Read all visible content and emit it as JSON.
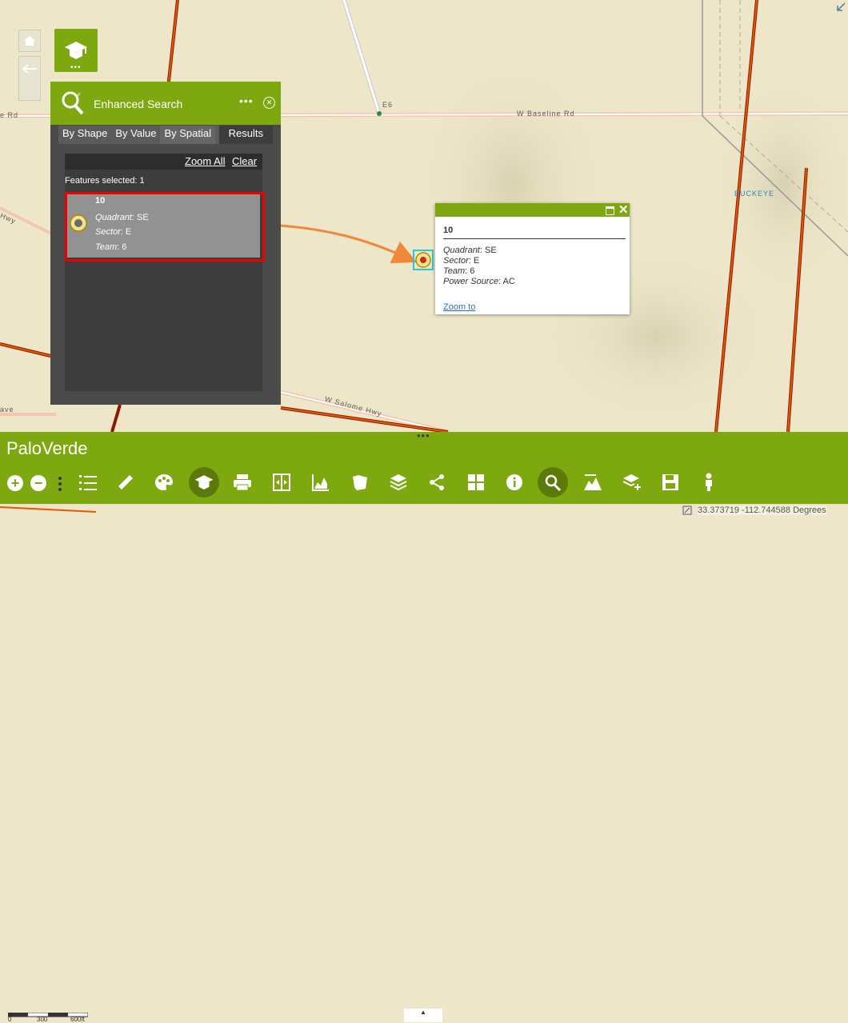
{
  "map": {
    "roads": {
      "baseline": "W Baseline Rd",
      "baseline_left": "e Rd",
      "e6": "E6",
      "buckeye": "BUCKEYE",
      "hwy": "Hwy",
      "saddle": "W Salome Hwy",
      "ave": "ave"
    }
  },
  "widget": {
    "icon": "grad-cap-icon"
  },
  "panel": {
    "title": "Enhanced Search",
    "tabs": [
      "By Shape",
      "By Value",
      "By Spatial",
      "Results"
    ],
    "active_tab": "Results",
    "zoom_all": "Zoom All",
    "clear": "Clear",
    "features_selected": "Features selected: 1",
    "result": {
      "title": "10",
      "rows": [
        {
          "label": "Quadrant",
          "value": ": SE"
        },
        {
          "label": "Sector",
          "value": ": E"
        },
        {
          "label": "Team",
          "value": ": 6"
        }
      ]
    }
  },
  "popup": {
    "title": "10",
    "rows": [
      {
        "label": "Quadrant",
        "value": ": SE"
      },
      {
        "label": "Sector",
        "value": ": E"
      },
      {
        "label": "Team",
        "value": ": 6"
      },
      {
        "label": "Power Source",
        "value": ": AC"
      }
    ],
    "zoom_to": "Zoom to"
  },
  "app": {
    "title": "PaloVerde"
  },
  "status": {
    "coordinates": "33.373719 -112.744588 Degrees"
  },
  "scalebar": {
    "labels": [
      "0",
      "300",
      "600ft"
    ]
  },
  "colors": {
    "accent": "#7ea80f",
    "highlight": "#e00000",
    "arrow": "#f0883c"
  }
}
